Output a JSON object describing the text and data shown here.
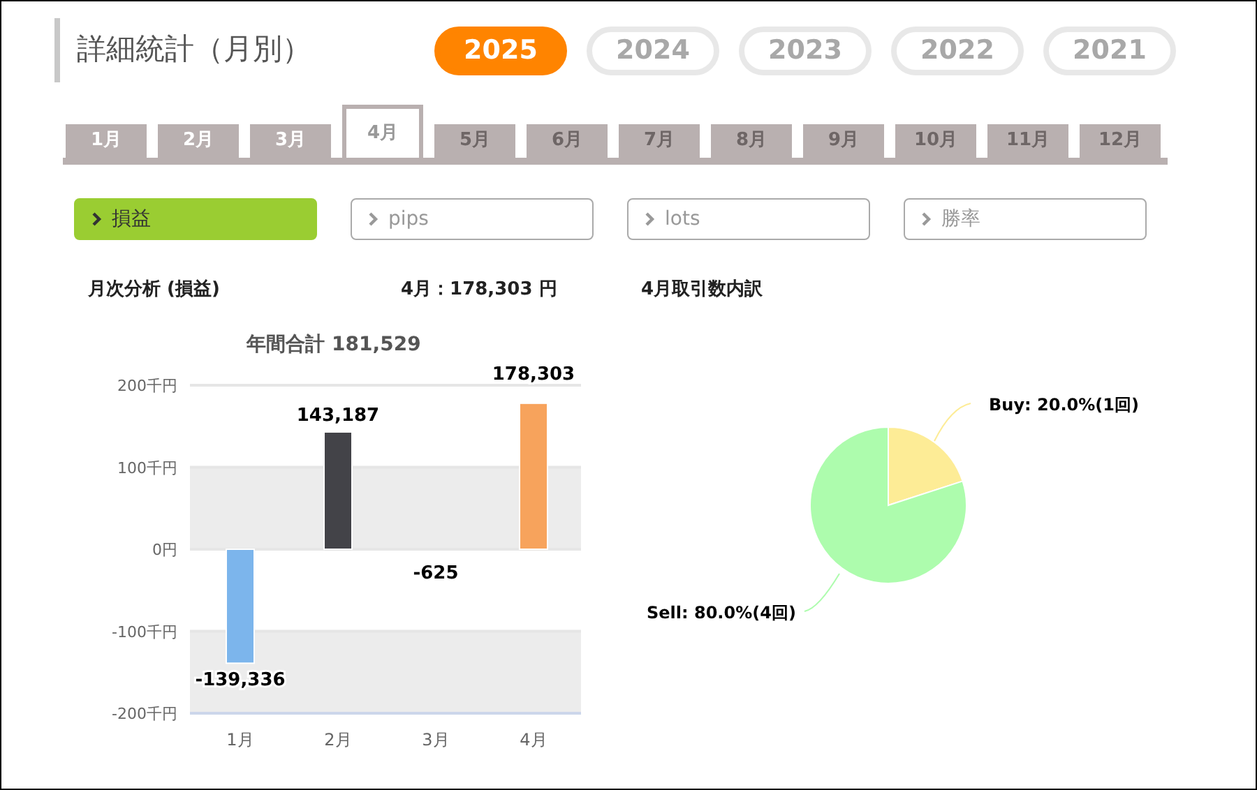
{
  "title": "詳細統計（月別）",
  "years": [
    {
      "label": "2025",
      "selected": true
    },
    {
      "label": "2024",
      "selected": false
    },
    {
      "label": "2023",
      "selected": false
    },
    {
      "label": "2022",
      "selected": false
    },
    {
      "label": "2021",
      "selected": false
    }
  ],
  "months": [
    {
      "label": "1月",
      "selected": false,
      "disabled": false
    },
    {
      "label": "2月",
      "selected": false,
      "disabled": false
    },
    {
      "label": "3月",
      "selected": false,
      "disabled": false
    },
    {
      "label": "4月",
      "selected": true,
      "disabled": false
    },
    {
      "label": "5月",
      "selected": false,
      "disabled": true
    },
    {
      "label": "6月",
      "selected": false,
      "disabled": true
    },
    {
      "label": "7月",
      "selected": false,
      "disabled": true
    },
    {
      "label": "8月",
      "selected": false,
      "disabled": true
    },
    {
      "label": "9月",
      "selected": false,
      "disabled": true
    },
    {
      "label": "10月",
      "selected": false,
      "disabled": true
    },
    {
      "label": "11月",
      "selected": false,
      "disabled": true
    },
    {
      "label": "12月",
      "selected": false,
      "disabled": true
    }
  ],
  "metric_tabs": [
    {
      "label": "損益",
      "selected": true
    },
    {
      "label": "pips",
      "selected": false
    },
    {
      "label": "lots",
      "selected": false
    },
    {
      "label": "勝率",
      "selected": false
    }
  ],
  "monthly_analysis": {
    "heading": "月次分析 (損益)",
    "month_total": "4月：178,303 円",
    "chart_data": {
      "type": "bar",
      "title": "年間合計 181,529",
      "categories": [
        "1月",
        "2月",
        "3月",
        "4月"
      ],
      "series": [
        {
          "values": [
            -139,
            143,
            null,
            178
          ]
        }
      ],
      "colors": [
        "#7cb5ec",
        "#434348",
        null,
        "#f7a35c"
      ],
      "ylim": [
        -200,
        200
      ],
      "grid": true,
      "yticks": [
        {
          "value": 200,
          "label": "200千円"
        },
        {
          "value": 100,
          "label": "100千円"
        },
        {
          "value": 0,
          "label": "0円"
        },
        {
          "value": -100,
          "label": "-100千円"
        },
        {
          "value": -200,
          "label": "-200千円"
        }
      ],
      "value_labels": [
        "-139,336",
        "143,187",
        "-625",
        "178,303"
      ]
    }
  },
  "trade_breakdown": {
    "heading": "4月取引数内訳",
    "chart_data": {
      "type": "pie",
      "values": [
        1,
        4
      ],
      "colors": [
        "#fdec96",
        "#adfcad"
      ],
      "value_labels": [
        "Buy: 20.0%(1回)",
        "Sell: 80.0%(4回)"
      ]
    }
  }
}
